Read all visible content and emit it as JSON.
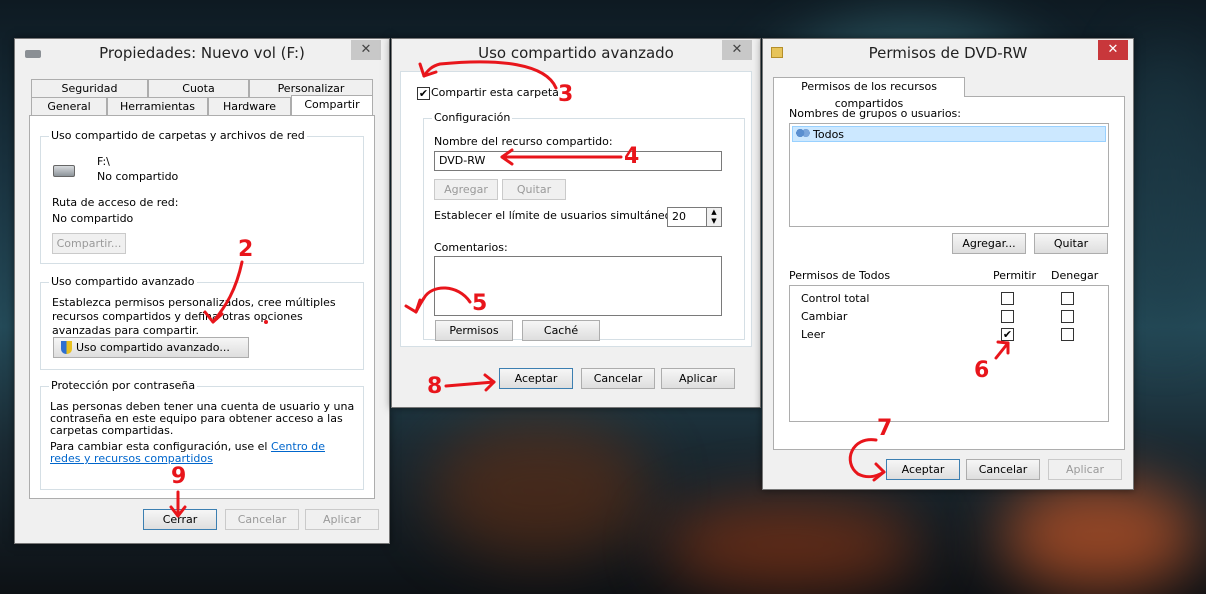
{
  "dlg1": {
    "title": "Propiedades: Nuevo vol (F:)",
    "tabs_row1": [
      "Seguridad",
      "Cuota",
      "Personalizar"
    ],
    "tabs_row2": [
      "General",
      "Herramientas",
      "Hardware",
      "Compartir"
    ],
    "grp_net": "Uso compartido de carpetas y archivos de red",
    "drive_path": "F:\\",
    "drive_status": "No compartido",
    "net_path_label": "Ruta de acceso de red:",
    "net_path_value": "No compartido",
    "share_button": "Compartir...",
    "grp_adv": "Uso compartido avanzado",
    "adv_desc": "Establezca permisos personalizados, cree múltiples recursos compartidos y defina otras opciones avanzadas para compartir.",
    "adv_button": "Uso compartido avanzado...",
    "grp_pwd": "Protección por contraseña",
    "pwd_desc": "Las personas deben tener una cuenta de usuario y una contraseña en este equipo para obtener acceso a las carpetas compartidas.",
    "pwd_desc2": "Para cambiar esta configuración, use el",
    "pwd_link": "Centro de redes y recursos compartidos",
    "close_button": "Cerrar",
    "cancel_button": "Cancelar",
    "apply_button": "Aplicar"
  },
  "dlg2": {
    "title": "Uso compartido avanzado",
    "share_checkbox": "Compartir esta carpeta",
    "grp_config": "Configuración",
    "share_name_label": "Nombre del recurso compartido:",
    "share_name_value": "DVD-RW",
    "add_button": "Agregar",
    "remove_button": "Quitar",
    "limit_label": "Establecer el límite de usuarios simultáneos en:",
    "limit_value": "20",
    "comments_label": "Comentarios:",
    "perm_button": "Permisos",
    "cache_button": "Caché",
    "ok_button": "Aceptar",
    "cancel_button": "Cancelar",
    "apply_button": "Aplicar"
  },
  "dlg3": {
    "title": "Permisos de DVD-RW",
    "tab": "Permisos de los recursos compartidos",
    "users_label": "Nombres de grupos o usuarios:",
    "user": "Todos",
    "add_button": "Agregar...",
    "remove_button": "Quitar",
    "perm_label": "Permisos de Todos",
    "allow_label": "Permitir",
    "deny_label": "Denegar",
    "permissions": [
      {
        "name": "Control total",
        "allow": false,
        "deny": false
      },
      {
        "name": "Cambiar",
        "allow": false,
        "deny": false
      },
      {
        "name": "Leer",
        "allow": true,
        "deny": false
      }
    ],
    "ok_button": "Aceptar",
    "cancel_button": "Cancelar",
    "apply_button": "Aplicar"
  },
  "annotations": [
    "2",
    "3",
    "4",
    "5",
    "6",
    "7",
    "8",
    "9"
  ],
  "colors": {
    "annotation": "#e8151b",
    "close_red": "#c8373b",
    "selection": "#cce8ff"
  }
}
